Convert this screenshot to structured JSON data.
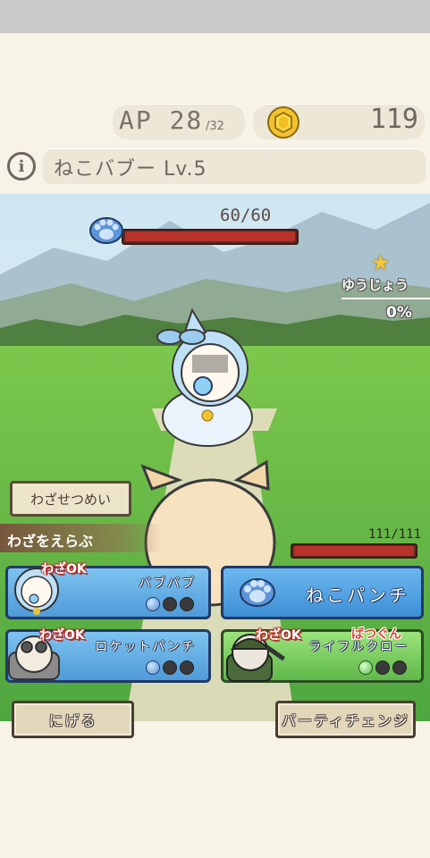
{
  "hud": {
    "ap_label": "AP 28",
    "ap_max": "/32",
    "coins": "119"
  },
  "enemy": {
    "name": "ねこバブー Lv.5",
    "hp_text": "60/60",
    "hp_fraction": 1.0
  },
  "victory": {
    "label": "ゆうじょう",
    "percent": "0%"
  },
  "help_button": "わざせつめい",
  "select_label": "わざをえらぶ",
  "player": {
    "hp_text": "111/111",
    "hp_fraction": 1.0
  },
  "skills": [
    {
      "name": "バブバブ",
      "badge": "わざOK",
      "extra": "",
      "color": "blue",
      "charges_on": 1,
      "charges_total": 3
    },
    {
      "name": "ロケットパンチ",
      "badge": "わざOK",
      "extra": "",
      "color": "blue",
      "charges_on": 1,
      "charges_total": 3
    },
    {
      "name": "ライフルクロー",
      "badge": "わざOK",
      "extra": "ばつぐん",
      "color": "green",
      "charges_on": 1,
      "charges_total": 3
    }
  ],
  "attack_button": "ねこパンチ",
  "run_button": "にげる",
  "party_button": "パーティチェンジ",
  "colors": {
    "hp_bar": "#b8322c",
    "skill_blue": "#4f9bd9",
    "skill_green": "#5fb84a",
    "coin": "#f0c020",
    "bg": "#f7f3e6"
  }
}
